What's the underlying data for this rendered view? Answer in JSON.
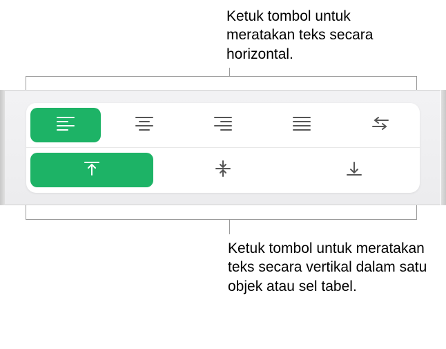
{
  "callouts": {
    "top": "Ketuk tombol untuk meratakan teks secara horizontal.",
    "bottom": "Ketuk tombol untuk meratakan teks secara vertikal dalam satu objek atau sel tabel."
  },
  "alignment": {
    "horizontal": {
      "left": {
        "active": true
      },
      "center": {
        "active": false
      },
      "right": {
        "active": false
      },
      "justify": {
        "active": false
      },
      "direction": {
        "active": false
      }
    },
    "vertical": {
      "top": {
        "active": true
      },
      "middle": {
        "active": false
      },
      "bottom": {
        "active": false
      }
    }
  },
  "colors": {
    "accent": "#1DB366"
  }
}
